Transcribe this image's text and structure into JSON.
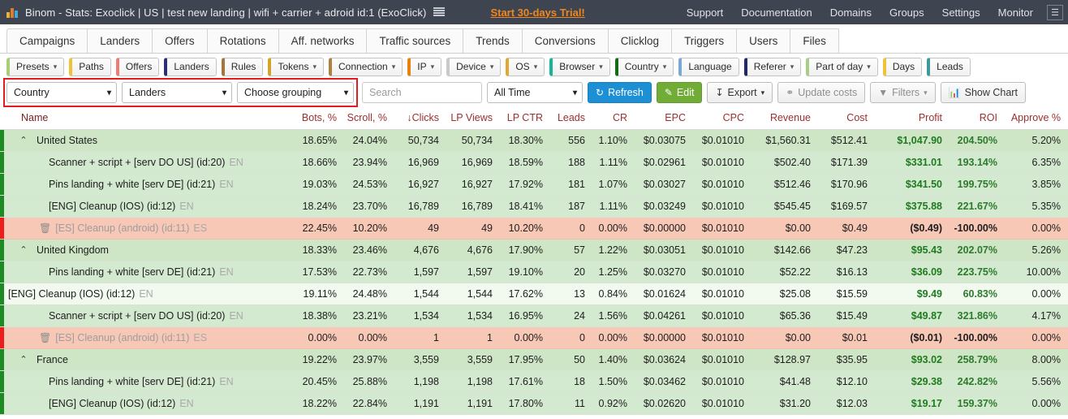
{
  "topbar": {
    "brand": "Binom",
    "title": "Binom - Stats: Exoclick | US | test new landing | wifi + carrier + adroid id:1 (ExoClick)",
    "list_icon": "list-icon",
    "trial": "Start 30-days Trial!",
    "links": [
      "Support",
      "Documentation",
      "Domains",
      "Groups",
      "Settings",
      "Monitor"
    ],
    "user_icon": "user-icon",
    "bg": "#3e4551",
    "trial_color": "#f0871e"
  },
  "main_tabs": [
    "Campaigns",
    "Landers",
    "Offers",
    "Rotations",
    "Aff. networks",
    "Traffic sources",
    "Trends",
    "Conversions",
    "Clicklog",
    "Triggers",
    "Users",
    "Files"
  ],
  "chips": [
    {
      "label": "Presets",
      "caret": true,
      "color": "#a8cf78"
    },
    {
      "label": "Paths",
      "caret": false,
      "color": "#f0c23a"
    },
    {
      "label": "Offers",
      "caret": false,
      "color": "#ef7b72"
    },
    {
      "label": "Landers",
      "caret": false,
      "color": "#2b2f77"
    },
    {
      "label": "Rules",
      "caret": false,
      "color": "#a9743a"
    },
    {
      "label": "Tokens",
      "caret": true,
      "color": "#d3a429"
    },
    {
      "label": "Connection",
      "caret": true,
      "color": "#b0803c"
    },
    {
      "label": "IP",
      "caret": true,
      "color": "#e8820e"
    },
    {
      "label": "Device",
      "caret": true,
      "color": "#c9c9c9"
    },
    {
      "label": "OS",
      "caret": true,
      "color": "#e0a832"
    },
    {
      "label": "Browser",
      "caret": true,
      "color": "#16b59a"
    },
    {
      "label": "Country",
      "caret": true,
      "color": "#146b17"
    },
    {
      "label": "Language",
      "caret": false,
      "color": "#7aa8d6"
    },
    {
      "label": "Referer",
      "caret": true,
      "color": "#1d2a6e"
    },
    {
      "label": "Part of day",
      "caret": true,
      "color": "#a9cf85"
    },
    {
      "label": "Days",
      "caret": false,
      "color": "#f0c23a"
    },
    {
      "label": "Leads",
      "caret": false,
      "color": "#3e9a9a"
    }
  ],
  "controls": {
    "grouping1": "Country",
    "grouping2": "Landers",
    "grouping3": "Choose grouping",
    "search_placeholder": "Search",
    "date_range": "All Time",
    "refresh": "Refresh",
    "edit": "Edit",
    "export": "Export",
    "update_costs": "Update costs",
    "filters": "Filters",
    "show_chart": "Show Chart",
    "highlight_color": "#e31b23"
  },
  "table": {
    "columns": [
      "Name",
      "Bots, %",
      "Scroll, %",
      "Clicks",
      "LP Views",
      "LP CTR",
      "Leads",
      "CR",
      "EPC",
      "CPC",
      "Revenue",
      "Cost",
      "Profit",
      "ROI",
      "Approve %"
    ],
    "sorted_column": "Clicks",
    "sort_icon": "arrow-down-icon",
    "rows": [
      {
        "type": "group",
        "expanded": true,
        "name": "United States",
        "lang": "",
        "bots": "18.65%",
        "scroll": "24.04%",
        "clicks": "50,734",
        "lp_views": "50,734",
        "lp_ctr": "18.30%",
        "leads": "556",
        "cr": "1.10%",
        "epc": "$0.03075",
        "cpc": "$0.01010",
        "revenue": "$1,560.31",
        "cost": "$512.41",
        "profit": "$1,047.90",
        "profit_sign": "pos",
        "roi": "204.50%",
        "roi_sign": "pos",
        "approve": "5.20%"
      },
      {
        "type": "child",
        "name": "Scanner + script + [serv DO US] (id:20)",
        "lang": "EN",
        "bots": "18.66%",
        "scroll": "23.94%",
        "clicks": "16,969",
        "lp_views": "16,969",
        "lp_ctr": "18.59%",
        "leads": "188",
        "cr": "1.11%",
        "epc": "$0.02961",
        "cpc": "$0.01010",
        "revenue": "$502.40",
        "cost": "$171.39",
        "profit": "$331.01",
        "profit_sign": "pos",
        "roi": "193.14%",
        "roi_sign": "pos",
        "approve": "6.35%"
      },
      {
        "type": "child",
        "name": "Pins landing + white [serv DE] (id:21)",
        "lang": "EN",
        "bots": "19.03%",
        "scroll": "24.53%",
        "clicks": "16,927",
        "lp_views": "16,927",
        "lp_ctr": "17.92%",
        "leads": "181",
        "cr": "1.07%",
        "epc": "$0.03027",
        "cpc": "$0.01010",
        "revenue": "$512.46",
        "cost": "$170.96",
        "profit": "$341.50",
        "profit_sign": "pos",
        "roi": "199.75%",
        "roi_sign": "pos",
        "approve": "3.85%"
      },
      {
        "type": "child",
        "name": "[ENG] Cleanup (IOS) (id:12)",
        "lang": "EN",
        "bots": "18.24%",
        "scroll": "23.70%",
        "clicks": "16,789",
        "lp_views": "16,789",
        "lp_ctr": "18.41%",
        "leads": "187",
        "cr": "1.11%",
        "epc": "$0.03249",
        "cpc": "$0.01010",
        "revenue": "$545.45",
        "cost": "$169.57",
        "profit": "$375.88",
        "profit_sign": "pos",
        "roi": "221.67%",
        "roi_sign": "pos",
        "approve": "5.35%"
      },
      {
        "type": "deleted",
        "name": "[ES] Cleanup (android) (id:11)",
        "lang": "ES",
        "bots": "22.45%",
        "scroll": "10.20%",
        "clicks": "49",
        "lp_views": "49",
        "lp_ctr": "10.20%",
        "leads": "0",
        "cr": "0.00%",
        "epc": "$0.00000",
        "cpc": "$0.01010",
        "revenue": "$0.00",
        "cost": "$0.49",
        "profit": "($0.49)",
        "profit_sign": "neg",
        "roi": "-100.00%",
        "roi_sign": "neg",
        "approve": "0.00%"
      },
      {
        "type": "group",
        "expanded": true,
        "name": "United Kingdom",
        "lang": "",
        "bots": "18.33%",
        "scroll": "23.46%",
        "clicks": "4,676",
        "lp_views": "4,676",
        "lp_ctr": "17.90%",
        "leads": "57",
        "cr": "1.22%",
        "epc": "$0.03051",
        "cpc": "$0.01010",
        "revenue": "$142.66",
        "cost": "$47.23",
        "profit": "$95.43",
        "profit_sign": "pos",
        "roi": "202.07%",
        "roi_sign": "pos",
        "approve": "5.26%"
      },
      {
        "type": "child",
        "name": "Pins landing + white [serv DE] (id:21)",
        "lang": "EN",
        "bots": "17.53%",
        "scroll": "22.73%",
        "clicks": "1,597",
        "lp_views": "1,597",
        "lp_ctr": "19.10%",
        "leads": "20",
        "cr": "1.25%",
        "epc": "$0.03270",
        "cpc": "$0.01010",
        "revenue": "$52.22",
        "cost": "$16.13",
        "profit": "$36.09",
        "profit_sign": "pos",
        "roi": "223.75%",
        "roi_sign": "pos",
        "approve": "10.00%"
      },
      {
        "type": "light",
        "name": "[ENG] Cleanup (IOS) (id:12)",
        "lang": "EN",
        "bots": "19.11%",
        "scroll": "24.48%",
        "clicks": "1,544",
        "lp_views": "1,544",
        "lp_ctr": "17.62%",
        "leads": "13",
        "cr": "0.84%",
        "epc": "$0.01624",
        "cpc": "$0.01010",
        "revenue": "$25.08",
        "cost": "$15.59",
        "profit": "$9.49",
        "profit_sign": "pos",
        "roi": "60.83%",
        "roi_sign": "pos",
        "approve": "0.00%"
      },
      {
        "type": "child",
        "name": "Scanner + script + [serv DO US] (id:20)",
        "lang": "EN",
        "bots": "18.38%",
        "scroll": "23.21%",
        "clicks": "1,534",
        "lp_views": "1,534",
        "lp_ctr": "16.95%",
        "leads": "24",
        "cr": "1.56%",
        "epc": "$0.04261",
        "cpc": "$0.01010",
        "revenue": "$65.36",
        "cost": "$15.49",
        "profit": "$49.87",
        "profit_sign": "pos",
        "roi": "321.86%",
        "roi_sign": "pos",
        "approve": "4.17%"
      },
      {
        "type": "deleted",
        "name": "[ES] Cleanup (android) (id:11)",
        "lang": "ES",
        "bots": "0.00%",
        "scroll": "0.00%",
        "clicks": "1",
        "lp_views": "1",
        "lp_ctr": "0.00%",
        "leads": "0",
        "cr": "0.00%",
        "epc": "$0.00000",
        "cpc": "$0.01010",
        "revenue": "$0.00",
        "cost": "$0.01",
        "profit": "($0.01)",
        "profit_sign": "neg",
        "roi": "-100.00%",
        "roi_sign": "neg",
        "approve": "0.00%"
      },
      {
        "type": "group",
        "expanded": true,
        "name": "France",
        "lang": "",
        "bots": "19.22%",
        "scroll": "23.97%",
        "clicks": "3,559",
        "lp_views": "3,559",
        "lp_ctr": "17.95%",
        "leads": "50",
        "cr": "1.40%",
        "epc": "$0.03624",
        "cpc": "$0.01010",
        "revenue": "$128.97",
        "cost": "$35.95",
        "profit": "$93.02",
        "profit_sign": "pos",
        "roi": "258.79%",
        "roi_sign": "pos",
        "approve": "8.00%"
      },
      {
        "type": "child",
        "name": "Pins landing + white [serv DE] (id:21)",
        "lang": "EN",
        "bots": "20.45%",
        "scroll": "25.88%",
        "clicks": "1,198",
        "lp_views": "1,198",
        "lp_ctr": "17.61%",
        "leads": "18",
        "cr": "1.50%",
        "epc": "$0.03462",
        "cpc": "$0.01010",
        "revenue": "$41.48",
        "cost": "$12.10",
        "profit": "$29.38",
        "profit_sign": "pos",
        "roi": "242.82%",
        "roi_sign": "pos",
        "approve": "5.56%"
      },
      {
        "type": "child",
        "name": "[ENG] Cleanup (IOS) (id:12)",
        "lang": "EN",
        "bots": "18.22%",
        "scroll": "22.84%",
        "clicks": "1,191",
        "lp_views": "1,191",
        "lp_ctr": "17.80%",
        "leads": "11",
        "cr": "0.92%",
        "epc": "$0.02620",
        "cpc": "$0.01010",
        "revenue": "$31.20",
        "cost": "$12.03",
        "profit": "$19.17",
        "profit_sign": "pos",
        "roi": "159.37%",
        "roi_sign": "pos",
        "approve": "0.00%"
      }
    ]
  }
}
